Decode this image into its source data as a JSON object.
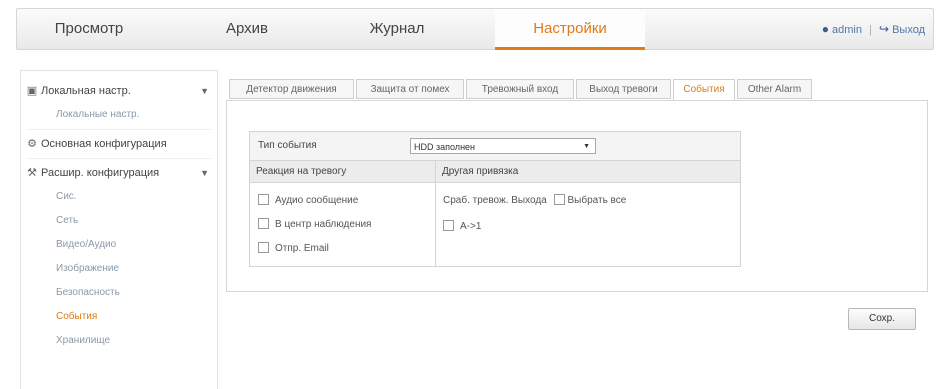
{
  "topnav": {
    "items": [
      {
        "label": "Просмотр"
      },
      {
        "label": "Архив"
      },
      {
        "label": "Журнал"
      },
      {
        "label": "Настройки"
      }
    ],
    "user": "admin",
    "logout": "Выход"
  },
  "sidebar": {
    "groups": [
      {
        "label": "Локальная настр.",
        "subitems": [
          "Локальные настр."
        ]
      },
      {
        "label": "Основная конфигурация",
        "subitems": []
      },
      {
        "label": "Расшир. конфигурация",
        "subitems": [
          "Сис.",
          "Сеть",
          "Видео/Аудио",
          "Изображение",
          "Безопасность",
          "События",
          "Хранилище"
        ]
      }
    ],
    "active_item": "События"
  },
  "tabs": [
    {
      "label": "Детектор движения"
    },
    {
      "label": "Защита от помех"
    },
    {
      "label": "Тревожный вход"
    },
    {
      "label": "Выход тревоги"
    },
    {
      "label": "События"
    },
    {
      "label": "Other Alarm"
    }
  ],
  "active_tab": "События",
  "form": {
    "event_type_label": "Тип события",
    "event_type_value": "HDD заполнен",
    "reaction_header": "Реакция на тревогу",
    "linkage_header": "Другая привязка",
    "reactions": [
      {
        "label": "Аудио сообщение",
        "checked": false
      },
      {
        "label": "В центр наблюдения",
        "checked": false
      },
      {
        "label": "Отпр. Email",
        "checked": false
      }
    ],
    "trigger_label": "Сраб. тревож. Выходa",
    "select_all_label": "Выбрать все",
    "select_all_checked": false,
    "outputs": [
      {
        "label": "A->1",
        "checked": false
      }
    ]
  },
  "save_label": "Сохр."
}
